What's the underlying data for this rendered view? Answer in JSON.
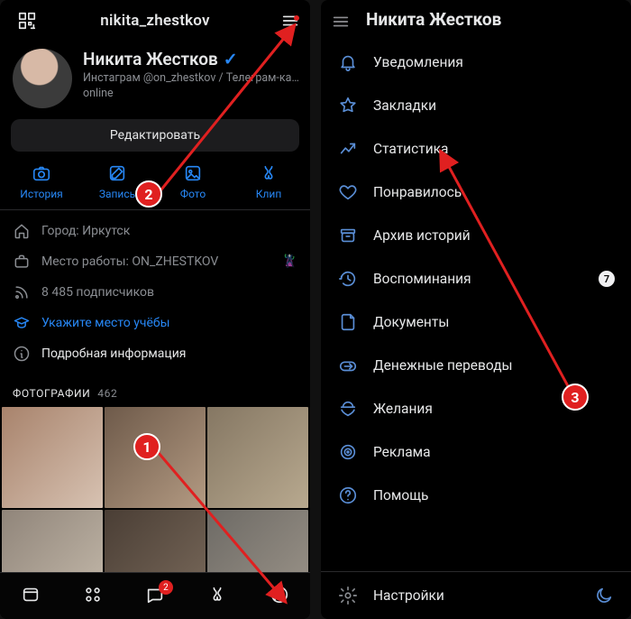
{
  "left": {
    "header": {
      "username": "nikita_zhestkov"
    },
    "profile": {
      "name": "Никита Жестков",
      "bio": "Инстаграм @on_zhestkov / Телеграм-ка…",
      "status": "online"
    },
    "edit_label": "Редактировать",
    "actions": [
      {
        "id": "story",
        "label": "История"
      },
      {
        "id": "post",
        "label": "Запись"
      },
      {
        "id": "photo",
        "label": "Фото"
      },
      {
        "id": "clip",
        "label": "Клип"
      }
    ],
    "info": {
      "city": "Город: Иркутск",
      "work": "Место работы: ON_ZHESTKOV",
      "followers": "8 485 подписчиков",
      "study": "Укажите место учёбы",
      "details": "Подробная информация"
    },
    "photos": {
      "title": "ФОТОГРАФИИ",
      "count": "462"
    },
    "tabbar": {
      "messages_badge": "2"
    }
  },
  "right": {
    "title": "Никита Жестков",
    "menu": [
      {
        "id": "notifications",
        "label": "Уведомления",
        "trail": "dot"
      },
      {
        "id": "bookmarks",
        "label": "Закладки"
      },
      {
        "id": "stats",
        "label": "Статистика"
      },
      {
        "id": "liked",
        "label": "Понравилось"
      },
      {
        "id": "archive",
        "label": "Архив историй"
      },
      {
        "id": "memories",
        "label": "Воспоминания",
        "trail": "7"
      },
      {
        "id": "documents",
        "label": "Документы"
      },
      {
        "id": "money",
        "label": "Денежные переводы"
      },
      {
        "id": "wishes",
        "label": "Желания"
      },
      {
        "id": "ads",
        "label": "Реклама"
      },
      {
        "id": "help",
        "label": "Помощь"
      }
    ],
    "footer": {
      "settings": "Настройки"
    }
  },
  "annotations": {
    "n1": "1",
    "n2": "2",
    "n3": "3"
  }
}
